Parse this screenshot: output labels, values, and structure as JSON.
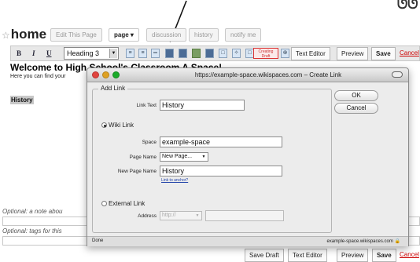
{
  "nav": {
    "home": "home",
    "tabs": [
      "Edit This Page",
      "page",
      "discussion",
      "history",
      "notify me"
    ]
  },
  "toolbar": {
    "heading_select": "Heading 3",
    "creating_label": "Creating Draft",
    "text_editor": "Text Editor",
    "preview": "Preview",
    "save": "Save",
    "cancel": "Cancel"
  },
  "page": {
    "title": "Welcome to High School's Classroom A Space!",
    "description": "Here you can find your",
    "history_heading": "History",
    "optional_note": "Optional: a note abou",
    "optional_tags": "Optional: tags for this"
  },
  "bottom_bar": {
    "save_draft": "Save Draft",
    "text_editor": "Text Editor",
    "preview": "Preview",
    "save": "Save",
    "cancel": "Cancel"
  },
  "dialog": {
    "title": "https://example-space.wikispaces.com – Create Link",
    "legend": "Add Link",
    "link_text_label": "Link Text",
    "link_text_value": "History",
    "wiki_link_label": "Wiki Link",
    "space_label": "Space",
    "space_value": "example-space",
    "page_name_label": "Page Name",
    "page_name_value": "New Page...",
    "new_page_name_label": "New Page Name",
    "new_page_name_value": "History",
    "anchor_link": "Link to anchor?",
    "external_link_label": "External Link",
    "address_label": "Address",
    "address_protocol": "http://",
    "ok": "OK",
    "cancel": "Cancel",
    "status_left": "Done",
    "status_right": "example-space.wikispaces.com"
  },
  "colors": {
    "traffic_red": "#e0443e",
    "traffic_yellow": "#dea123",
    "traffic_green": "#1aab29",
    "cancel_link": "#cc0000"
  }
}
